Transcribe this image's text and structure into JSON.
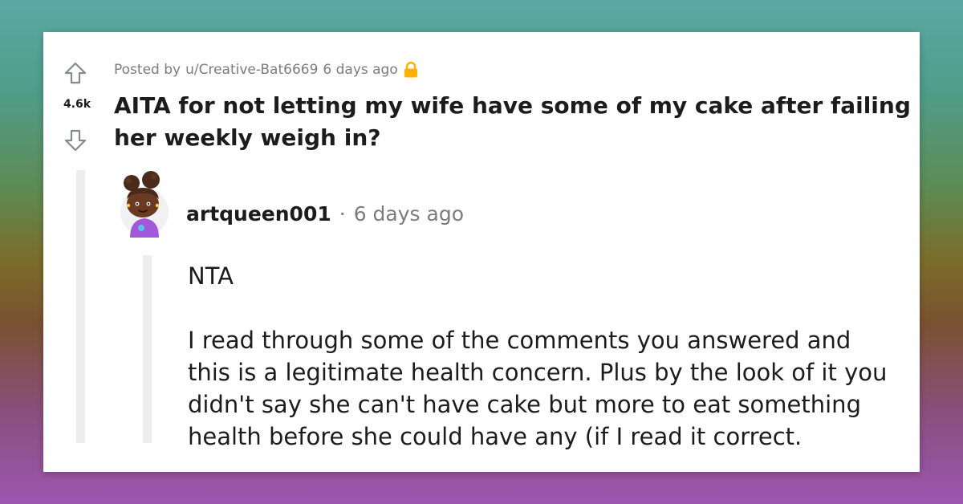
{
  "post": {
    "posted_by_prefix": "Posted by",
    "author": "u/Creative-Bat6669",
    "age": "6 days ago",
    "score": "4.6k",
    "title": "AITA for not letting my wife have some of my cake after failing her weekly weigh in?"
  },
  "comment": {
    "username": "artqueen001",
    "separator": "·",
    "age": "6 days ago",
    "paragraphs": [
      "NTA",
      "I read through some of the comments you answered and this is a legitimate health concern. Plus by the look of it you didn't say she can't have cake but more to eat something health before she could have any (if I read it correct."
    ]
  },
  "icons": {
    "upvote": "upvote-arrow-icon",
    "downvote": "downvote-arrow-icon",
    "lock": "lock-icon",
    "avatar": "snoo-avatar"
  },
  "colors": {
    "lock": "#ffb000",
    "meta_text": "#7c7c7c",
    "thread_line": "#ededed",
    "avatar_shirt": "#a259d9",
    "avatar_hair": "#4a2a1a"
  }
}
